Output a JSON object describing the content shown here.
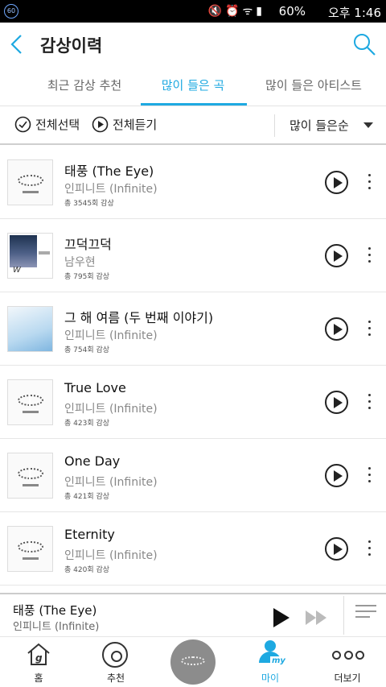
{
  "status_bar": {
    "left_badge": "60",
    "battery_text": "60%",
    "time": "오후 1:46",
    "icons": [
      "mute-icon",
      "alarm-icon",
      "wifi-icon",
      "signal-icon",
      "battery-icon"
    ]
  },
  "header": {
    "title": "감상이력"
  },
  "tabs": [
    {
      "label": "최근 감상 추천",
      "active": false
    },
    {
      "label": "많이 들은 곡",
      "active": true
    },
    {
      "label": "많이 들은 아티스트",
      "active": false
    }
  ],
  "actions": {
    "select_all": "전체선택",
    "play_all": "전체듣기",
    "sort": "많이 들은순"
  },
  "songs": [
    {
      "title": "태풍 (The Eye)",
      "artist": "인피니트 (Infinite)",
      "count": "총 3545회 감상",
      "cover": "infinite"
    },
    {
      "title": "끄덕끄덕",
      "artist": "남우현",
      "count": "총 795회 감상",
      "cover": "photo"
    },
    {
      "title": "그 해 여름 (두 번째 이야기)",
      "artist": "인피니트 (Infinite)",
      "count": "총 754회 감상",
      "cover": "blue"
    },
    {
      "title": "True Love",
      "artist": "인피니트 (Infinite)",
      "count": "총 423회 감상",
      "cover": "infinite"
    },
    {
      "title": "One Day",
      "artist": "인피니트 (Infinite)",
      "count": "총 421회 감상",
      "cover": "infinite"
    },
    {
      "title": "Eternity",
      "artist": "인피니트 (Infinite)",
      "count": "총 420회 감상",
      "cover": "infinite"
    }
  ],
  "player": {
    "title": "태풍 (The Eye)",
    "artist": "인피니트 (Infinite)"
  },
  "nav": [
    {
      "label": "홈",
      "icon": "home-icon"
    },
    {
      "label": "추천",
      "icon": "recommend-icon"
    },
    {
      "label": "",
      "icon": "album-disc-icon"
    },
    {
      "label": "마이",
      "icon": "my-icon",
      "active": true
    },
    {
      "label": "더보기",
      "icon": "more-icon"
    }
  ],
  "colors": {
    "accent": "#1ea9e1",
    "status_bar": "#000000"
  }
}
